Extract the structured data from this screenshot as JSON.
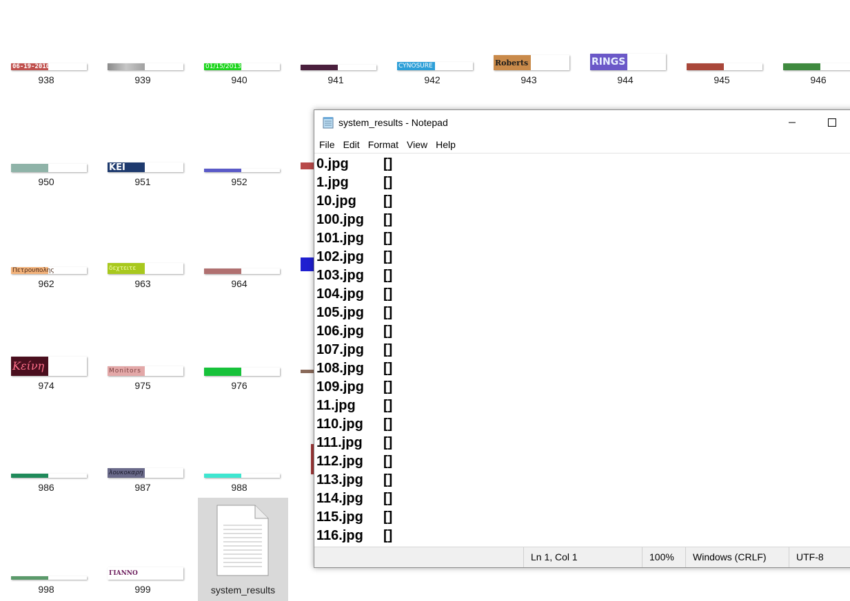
{
  "desktop": {
    "rows": [
      [
        "938",
        "939",
        "940",
        "941",
        "942",
        "943",
        "944",
        "945",
        "946"
      ],
      [
        "950",
        "951",
        "952"
      ],
      [
        "962",
        "963",
        "964"
      ],
      [
        "974",
        "975",
        "976"
      ],
      [
        "986",
        "987",
        "988"
      ],
      [
        "998",
        "999"
      ]
    ],
    "thumb_texts": {
      "938": "06-19-2010",
      "940": "01/15/2013",
      "942": "CYNOSURE",
      "943": "Roberts",
      "944": "RINGS",
      "951": "KEI",
      "962": "Πετρουπολης",
      "963": "δεχτειτε",
      "974": "Κείνη",
      "975": "Monitors",
      "987": "λουκοκαρη",
      "999": "ΓΙΑΝΝΟ"
    },
    "file_label": "system_results"
  },
  "notepad": {
    "title": "system_results - Notepad",
    "menu": [
      "File",
      "Edit",
      "Format",
      "View",
      "Help"
    ],
    "lines": [
      {
        "file": "0.jpg",
        "value": "[]"
      },
      {
        "file": "1.jpg",
        "value": "[]"
      },
      {
        "file": "10.jpg",
        "value": "[]"
      },
      {
        "file": "100.jpg",
        "value": "[]"
      },
      {
        "file": "101.jpg",
        "value": "[]"
      },
      {
        "file": "102.jpg",
        "value": "[]"
      },
      {
        "file": "103.jpg",
        "value": "[]"
      },
      {
        "file": "104.jpg",
        "value": "[]"
      },
      {
        "file": "105.jpg",
        "value": "[]"
      },
      {
        "file": "106.jpg",
        "value": "[]"
      },
      {
        "file": "107.jpg",
        "value": "[]"
      },
      {
        "file": "108.jpg",
        "value": "[]"
      },
      {
        "file": "109.jpg",
        "value": "[]"
      },
      {
        "file": "11.jpg",
        "value": "[]"
      },
      {
        "file": "110.jpg",
        "value": "[]"
      },
      {
        "file": "111.jpg",
        "value": "[]"
      },
      {
        "file": "112.jpg",
        "value": "[]"
      },
      {
        "file": "113.jpg",
        "value": "[]"
      },
      {
        "file": "114.jpg",
        "value": "[]"
      },
      {
        "file": "115.jpg",
        "value": "[]"
      },
      {
        "file": "116.jpg",
        "value": "[]"
      }
    ],
    "status": {
      "position": "Ln 1, Col 1",
      "zoom": "100%",
      "line_ending": "Windows (CRLF)",
      "encoding": "UTF-8"
    },
    "colors": {
      "status_bg": "#f0f0f0",
      "title_text": "#000000"
    }
  }
}
